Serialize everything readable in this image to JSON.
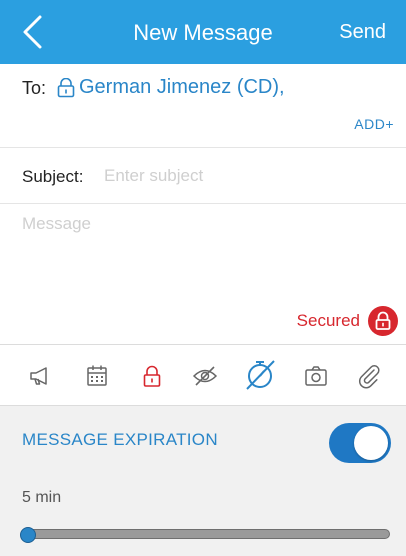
{
  "nav": {
    "title": "New Message",
    "send_label": "Send",
    "back_icon": "chevron-left-icon"
  },
  "recipients": {
    "to_label": "To:",
    "chip_name": "German Jimenez (CD),",
    "add_label": "ADD+"
  },
  "subject": {
    "label": "Subject:",
    "placeholder": "Enter subject",
    "value": ""
  },
  "message": {
    "placeholder": "Message",
    "value": ""
  },
  "secured": {
    "label": "Secured",
    "icon": "lock-icon"
  },
  "toolbar": {
    "icons": [
      "megaphone-icon",
      "calendar-icon",
      "lock-icon",
      "eye-off-icon",
      "no-timer-icon",
      "camera-icon",
      "paperclip-icon"
    ]
  },
  "expiration": {
    "label": "MESSAGE EXPIRATION",
    "enabled": true,
    "duration_label": "5 min",
    "slider_fraction": 0.0
  },
  "colors": {
    "accent": "#2b9fe0",
    "link": "#2a86c8",
    "secure_red": "#d7272e",
    "toggle_on": "#1f78c4"
  }
}
